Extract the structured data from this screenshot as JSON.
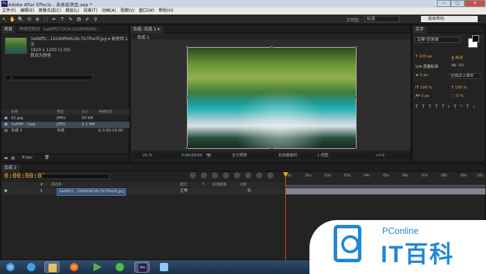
{
  "window": {
    "title": "Adobe After Effects - 未命名项目.aep *",
    "min": "—",
    "max": "□",
    "close": "✕"
  },
  "menu": [
    "文件(F)",
    "编辑(E)",
    "图像合成(C)",
    "图层(L)",
    "效果(T)",
    "动画(A)",
    "视图(V)",
    "窗口(W)",
    "帮助(H)"
  ],
  "toolbar": {
    "tools": [
      "↖",
      "✋",
      "🔍",
      "⟲",
      "⊕",
      "⬚",
      "✒",
      "T",
      "✎",
      "⛾",
      "✐",
      "⚲"
    ],
    "workspace_label": "工作区:",
    "workspace_value": "标准",
    "help_placeholder": "搜索帮助"
  },
  "project": {
    "tab": "项目",
    "tab2": "特效控制台: 3a68ff27263c1b289f6962...",
    "selected_name": "3a68ff2...1b289f69628c7b7f0e0f.jpg ▾ 被使用 1次",
    "selected_size": "1920 x 1200 (1.00)",
    "selected_color": "数百万颜色",
    "columns": [
      "名称",
      "类型",
      "大小",
      "持续时间"
    ],
    "items": [
      {
        "name": "01.jpg",
        "type": "JPEG",
        "size": "50 KB",
        "dur": ""
      },
      {
        "name": "3a68ff...f.jpg",
        "type": "JPEG",
        "size": "5.1 MB",
        "dur": ""
      },
      {
        "name": "合成 1",
        "type": "合成",
        "size": "",
        "dur": "Δ 0:00:10:00"
      }
    ],
    "bpc": "8 bpc"
  },
  "comp": {
    "tab": "合成: 合成 1 ▾",
    "subtab": "合成 1",
    "zoom": "25 %",
    "timecode": "0:00:00:00",
    "resolution": "全分辨率",
    "camera": "有效摄像机",
    "views": "1 视图",
    "exposure": "+0.0"
  },
  "character": {
    "tab": "文字",
    "font": "文鼎·仿宋体",
    "size": "103 px",
    "leading": "自动",
    "kerning_label": "度量标准",
    "tracking": "-50",
    "stroke_width": "0 px",
    "stroke_mode": "在描边上填充",
    "vscale": "100 %",
    "hscale": "100 %",
    "baseline": "0 px",
    "tsume": "0 %",
    "styles": [
      "T",
      "T",
      "TT",
      "Tr",
      "T¹",
      "T₁"
    ]
  },
  "timeline": {
    "tab": "合成 1",
    "time": "0:00:00:00",
    "columns": [
      "#",
      "源名称",
      "模式",
      "T",
      "轨道蒙板",
      "父级"
    ],
    "layer": {
      "index": "1",
      "name": "3a68ff2...289f69628c7b7f0e0f.jpg",
      "mode": "正常",
      "parent": "无"
    },
    "ruler": [
      "0s",
      "01s",
      "02s",
      "03s",
      "04s",
      "05s",
      "06s",
      "07s",
      "08s",
      "09s",
      "10s"
    ]
  },
  "watermark": {
    "brand": "PConline",
    "text": "IT百科"
  },
  "taskbar": [
    "start",
    "ie",
    "explorer",
    "firefox",
    "media",
    "360",
    "ae",
    "notepad"
  ]
}
